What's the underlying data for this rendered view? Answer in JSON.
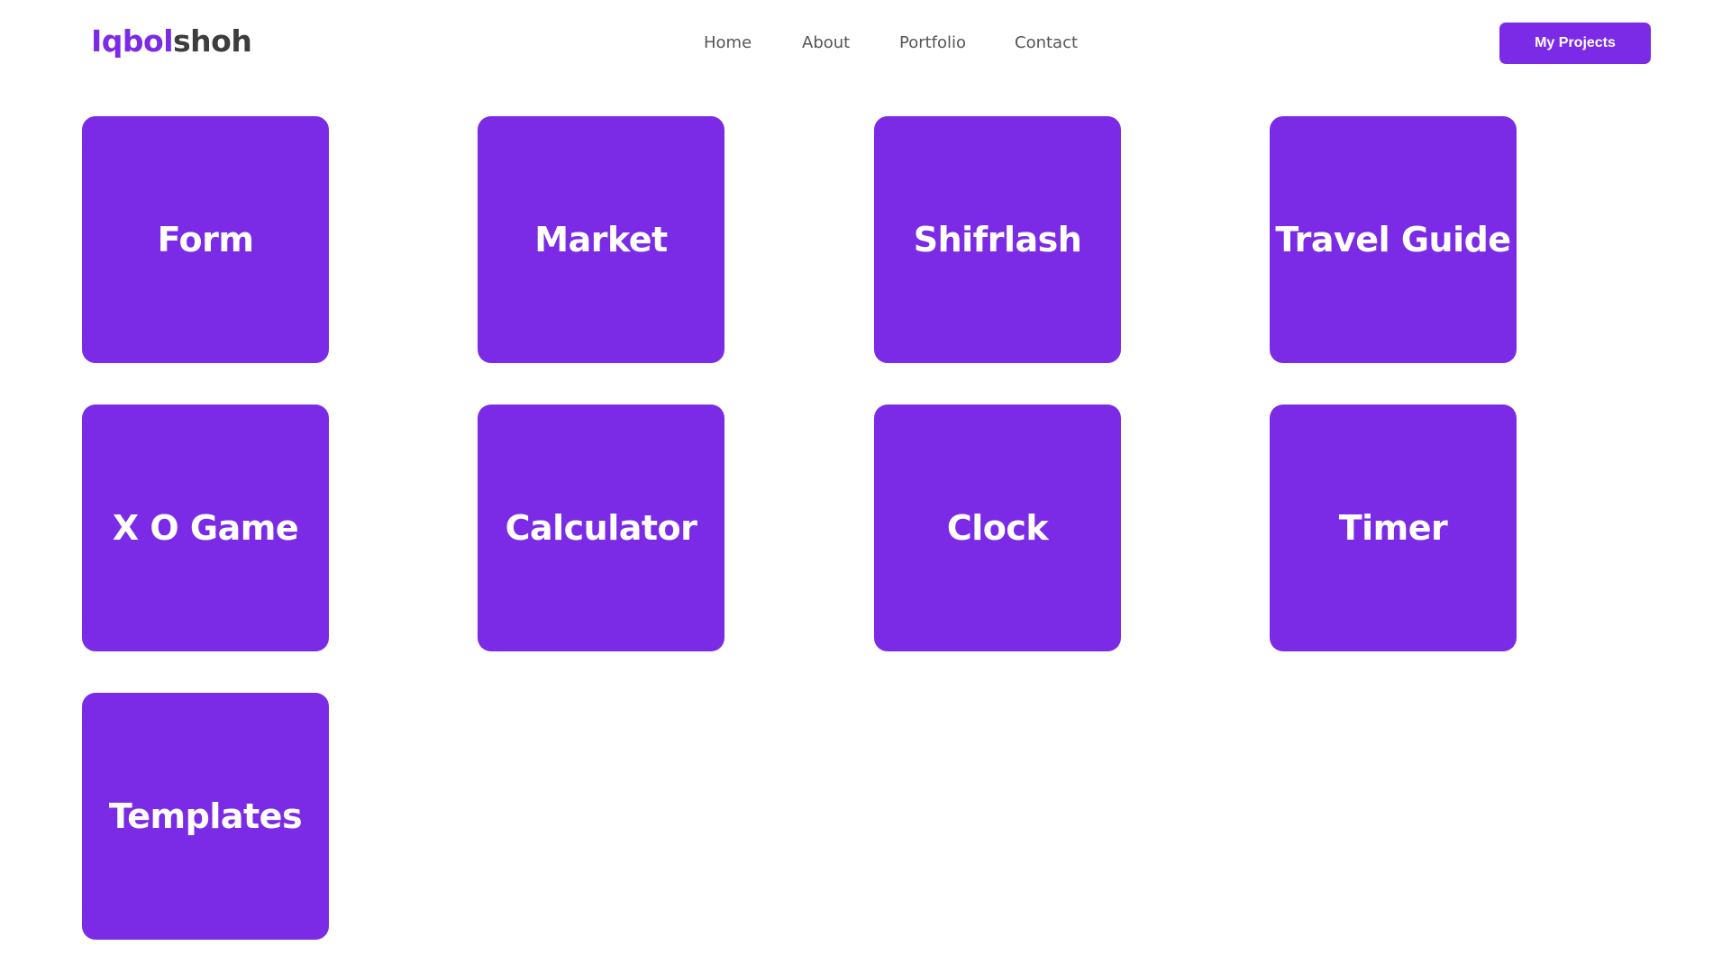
{
  "header": {
    "logo_accent": "Iqbol",
    "logo_rest": "shoh",
    "cta_label": "My Projects"
  },
  "nav": {
    "items": [
      "Home",
      "About",
      "Portfolio",
      "Contact"
    ]
  },
  "projects": [
    "Form",
    "Market",
    "Shifrlash",
    "Travel Guide",
    "X O Game",
    "Calculator",
    "Clock",
    "Timer",
    "Templates"
  ],
  "colors": {
    "accent": "#7b2be6",
    "logo_text": "#3d3d3d",
    "nav_text": "#555555",
    "card_text": "#ffffff",
    "background": "#ffffff"
  }
}
